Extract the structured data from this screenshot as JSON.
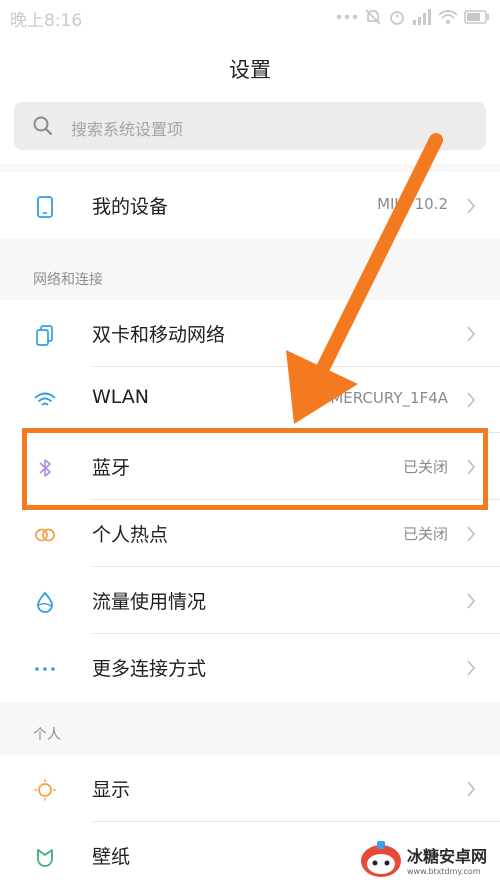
{
  "status_bar": {
    "time": "晚上8:16"
  },
  "header": {
    "title": "设置"
  },
  "search": {
    "placeholder": "搜索系统设置项"
  },
  "my_device": {
    "label": "我的设备",
    "value": "MIUI 10.2"
  },
  "network_section": {
    "title": "网络和连接",
    "items": [
      {
        "label": "双卡和移动网络",
        "value": "",
        "icon": "dual-sim-icon"
      },
      {
        "label": "WLAN",
        "value": "MERCURY_1F4A",
        "icon": "wifi-icon"
      },
      {
        "label": "蓝牙",
        "value": "已关闭",
        "icon": "bluetooth-icon"
      },
      {
        "label": "个人热点",
        "value": "已关闭",
        "icon": "hotspot-icon"
      },
      {
        "label": "流量使用情况",
        "value": "",
        "icon": "data-usage-icon"
      },
      {
        "label": "更多连接方式",
        "value": "",
        "icon": "more-dots-icon"
      }
    ]
  },
  "personal_section": {
    "title": "个人",
    "items": [
      {
        "label": "显示",
        "value": "",
        "icon": "display-icon"
      },
      {
        "label": "壁纸",
        "value": "",
        "icon": "wallpaper-icon"
      }
    ]
  },
  "watermark": {
    "main": "冰糖安卓网",
    "sub": "www.btxtdmy.com"
  },
  "colors": {
    "accent_orange": "#f47a20",
    "icon_blue": "#2f9fe0",
    "bluetooth_purple": "#a98be8"
  }
}
